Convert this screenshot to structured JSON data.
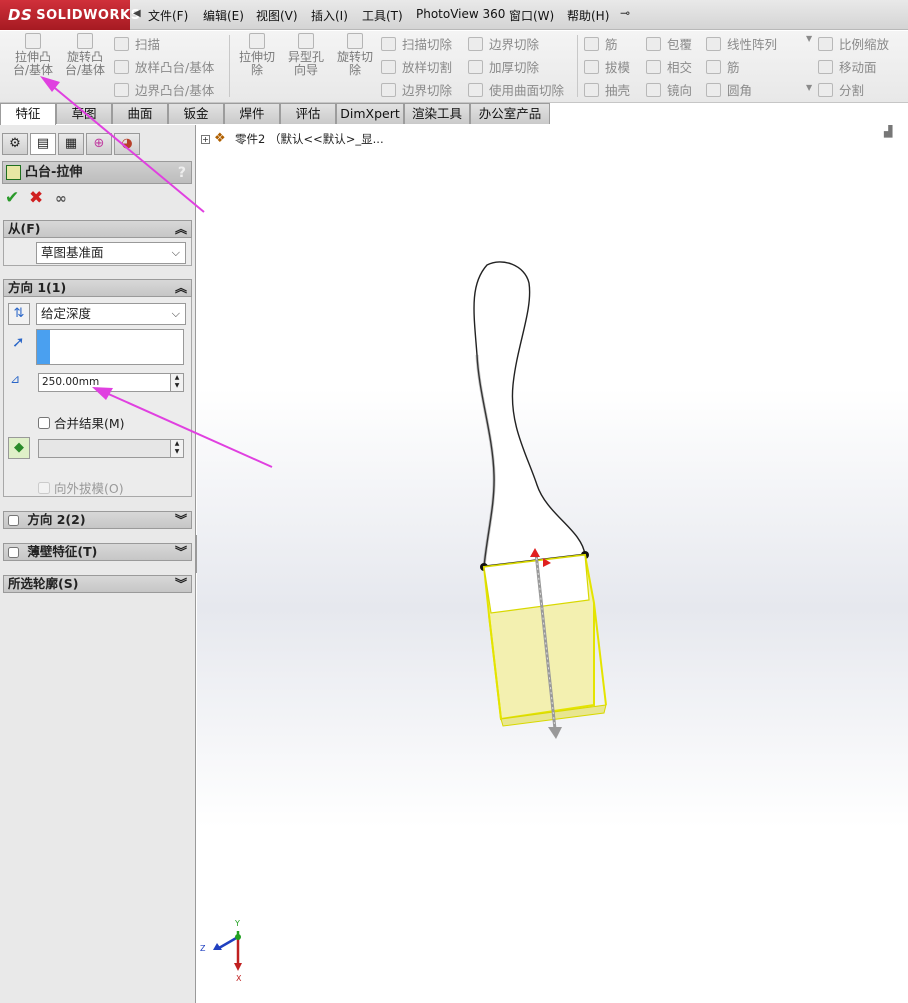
{
  "app": {
    "brand": "SOLIDWORKS",
    "brand_prefix": "DS"
  },
  "menu": [
    "文件(F)",
    "编辑(E)",
    "视图(V)",
    "插入(I)",
    "工具(T)",
    "PhotoView 360",
    "窗口(W)",
    "帮助(H)"
  ],
  "commands": {
    "extrude_boss": "拉伸凸\n台/基体",
    "revolve_boss": "旋转凸\n台/基体",
    "sweep": "扫描",
    "loft_boss": "放样凸台/基体",
    "boundary_boss": "边界凸台/基体",
    "extrude_cut": "拉伸切\n除",
    "hole_wizard": "异型孔\n向导",
    "revolve_cut": "旋转切\n除",
    "swept_cut": "扫描切除",
    "lofted_cut": "放样切割",
    "boundary_cut": "边界切除",
    "boundary_cut2": "边界切除",
    "thicken_cut": "加厚切除",
    "surface_cut": "使用曲面切除",
    "rib": "筋",
    "draft": "拔模",
    "shell": "抽壳",
    "wrap": "包覆",
    "intersect": "相交",
    "mirror": "镜向",
    "linear_pattern": "线性阵列",
    "rib2": "筋",
    "fillet": "圆角",
    "scale": "比例缩放",
    "move_face": "移动面",
    "split": "分割"
  },
  "tabs": [
    "特征",
    "草图",
    "曲面",
    "钣金",
    "焊件",
    "评估",
    "DimXpert",
    "渲染工具",
    "办公室产品"
  ],
  "property_manager": {
    "title": "凸台-拉伸",
    "help": "?",
    "from": {
      "label": "从(F)",
      "value": "草图基准面"
    },
    "direction1": {
      "label": "方向 1(1)",
      "end_condition": "给定深度",
      "depth": "250.00mm",
      "merge_result": "合并结果(M)",
      "draft_outward": "向外拔模(O)"
    },
    "direction2": {
      "label": "方向 2(2)"
    },
    "thin_feature": {
      "label": "薄壁特征(T)"
    },
    "selected_contours": {
      "label": "所选轮廓(S)"
    }
  },
  "tree": {
    "part_label": "零件2 （默认<<默认>_显..."
  },
  "triad": {
    "y": "Y",
    "z": "Z",
    "x": "X"
  },
  "colors": {
    "accent_red": "#c0282f",
    "annotation_arrow": "#e040e0",
    "preview_yellow": "#f3f0b0",
    "edge_yellow": "#e4e400"
  }
}
